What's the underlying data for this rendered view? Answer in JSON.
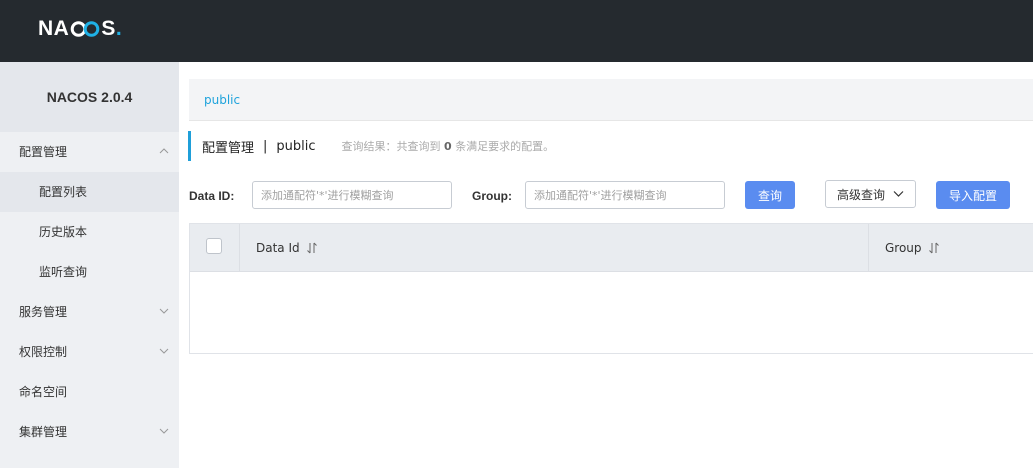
{
  "header": {
    "logo_pre": "NA",
    "logo_post": "S",
    "logo_dot": "."
  },
  "sidebar": {
    "version": "NACOS 2.0.4",
    "items": [
      {
        "label": "配置管理",
        "icon": "chevron-up-icon"
      },
      {
        "label": "配置列表"
      },
      {
        "label": "历史版本"
      },
      {
        "label": "监听查询"
      },
      {
        "label": "服务管理",
        "icon": "chevron-down-icon"
      },
      {
        "label": "权限控制",
        "icon": "chevron-down-icon"
      },
      {
        "label": "命名空间"
      },
      {
        "label": "集群管理",
        "icon": "chevron-down-icon"
      }
    ]
  },
  "namespace_bar": {
    "current": "public"
  },
  "page_title": {
    "main": "配置管理",
    "separator": "|",
    "namespace": "public",
    "hint_prefix": "查询结果：共查询到",
    "count": "0",
    "hint_suffix": "条满足要求的配置。"
  },
  "search": {
    "dataid_label": "Data ID:",
    "dataid_placeholder": "添加通配符'*'进行模糊查询",
    "group_label": "Group:",
    "group_placeholder": "添加通配符'*'进行模糊查询",
    "query_button": "查询",
    "advanced_button": "高级查询",
    "import_button": "导入配置"
  },
  "table": {
    "columns": [
      "Data Id",
      "Group"
    ],
    "rows": []
  },
  "colors": {
    "topbar": "#252a2f",
    "accent": "#1fa3dc",
    "primary_button": "#5a8cf0",
    "sidebar_bg": "#eef0f3"
  }
}
